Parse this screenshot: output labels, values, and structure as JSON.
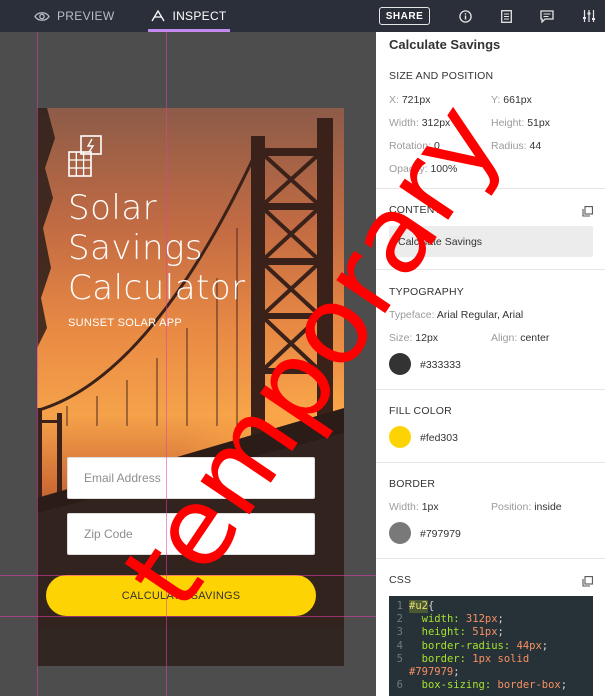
{
  "topbar": {
    "preview_label": "PREVIEW",
    "inspect_label": "INSPECT",
    "share_label": "SHARE",
    "icons": [
      "eye-icon",
      "inspect-icon",
      "info-icon",
      "document-icon",
      "comment-icon",
      "sliders-icon"
    ]
  },
  "artboard": {
    "title_lines": [
      "Solar",
      "Savings",
      "Calculator"
    ],
    "subtitle": "SUNSET SOLAR APP",
    "email_placeholder": "Email Address",
    "zip_placeholder": "Zip Code",
    "button_label": "CALCULATE SAVINGS"
  },
  "panel": {
    "title": "Calculate Savings",
    "size_position": {
      "heading": "SIZE AND POSITION",
      "x_label": "X:",
      "x_value": "721px",
      "y_label": "Y:",
      "y_value": "661px",
      "width_label": "Width:",
      "width_value": "312px",
      "height_label": "Height:",
      "height_value": "51px",
      "rotation_label": "Rotation:",
      "rotation_value": "0",
      "radius_label": "Radius:",
      "radius_value": "44",
      "opacity_label": "Opacity:",
      "opacity_value": "100%"
    },
    "content": {
      "heading": "CONTENT",
      "value": "Calculate Savings"
    },
    "typography": {
      "heading": "TYPOGRAPHY",
      "typeface_label": "Typeface:",
      "typeface_value": "Arial Regular, Arial",
      "size_label": "Size:",
      "size_value": "12px",
      "align_label": "Align:",
      "align_value": "center",
      "color": "#333333"
    },
    "fill": {
      "heading": "FILL COLOR",
      "color": "#fed303"
    },
    "border": {
      "heading": "BORDER",
      "width_label": "Width:",
      "width_value": "1px",
      "position_label": "Position:",
      "position_value": "inside",
      "color": "#797979"
    },
    "css": {
      "heading": "CSS",
      "line_numbers": [
        "1",
        "2",
        "3",
        "4",
        "5",
        "6"
      ],
      "selector": "#u2",
      "open_brace": " {",
      "width_prop": "width:",
      "width_val": "312px",
      "height_prop": "height:",
      "height_val": "51px",
      "radius_prop": "border-radius:",
      "radius_val": "44px",
      "border_prop": "border:",
      "border_val": "1px solid",
      "border_color": "#797979",
      "sizing_prop": "box-sizing:",
      "sizing_val": "border-box"
    }
  },
  "watermark": "temporary"
}
